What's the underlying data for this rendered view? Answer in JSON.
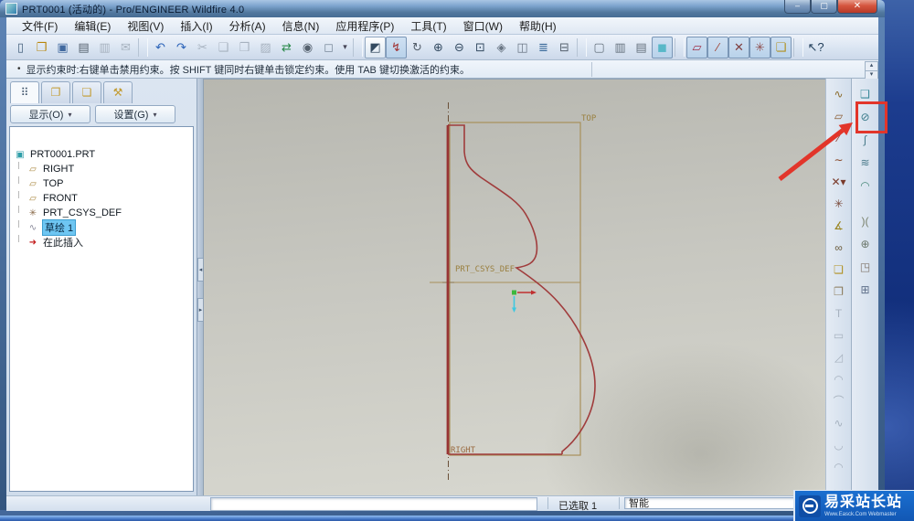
{
  "window": {
    "title": "PRT0001 (活动的) - Pro/ENGINEER Wildfire 4.0",
    "controls": {
      "minimize": "–",
      "maximize": "▢",
      "close": "✕"
    }
  },
  "menubar": {
    "items": [
      "文件(F)",
      "编辑(E)",
      "视图(V)",
      "插入(I)",
      "分析(A)",
      "信息(N)",
      "应用程序(P)",
      "工具(T)",
      "窗口(W)",
      "帮助(H)"
    ]
  },
  "toolbar": {
    "items": [
      {
        "name": "new-file-button",
        "glyph": "▯",
        "cls": "btn",
        "color": "#44607c"
      },
      {
        "name": "open-file-button",
        "glyph": "❐",
        "cls": "btn",
        "color": "#b8860b"
      },
      {
        "name": "save-button",
        "glyph": "▣",
        "cls": "btn",
        "color": "#41699f"
      },
      {
        "name": "print-button",
        "glyph": "▤",
        "cls": "btn",
        "color": "#55616e"
      },
      {
        "name": "print-to-file-button",
        "glyph": "▥",
        "cls": "btn dis"
      },
      {
        "name": "send-mail-button",
        "glyph": "✉",
        "cls": "btn dis"
      },
      {
        "cls": "sep"
      },
      {
        "name": "undo-button",
        "glyph": "↶",
        "cls": "btn",
        "color": "#2a62b8"
      },
      {
        "name": "redo-button",
        "glyph": "↷",
        "cls": "btn",
        "color": "#2a62b8"
      },
      {
        "name": "cut-button",
        "glyph": "✂",
        "cls": "btn dis"
      },
      {
        "name": "copy-button",
        "glyph": "❑",
        "cls": "btn dis"
      },
      {
        "name": "paste-button",
        "glyph": "❒",
        "cls": "btn dis"
      },
      {
        "name": "paste-special-button",
        "glyph": "▨",
        "cls": "btn dis"
      },
      {
        "name": "regenerate-button",
        "glyph": "⇄",
        "cls": "btn",
        "color": "#2a8a4a"
      },
      {
        "name": "find-button",
        "glyph": "◉",
        "cls": "btn",
        "color": "#55616e"
      },
      {
        "name": "select-box-button",
        "glyph": "◻",
        "cls": "btn",
        "color": "#7a8a9a"
      },
      {
        "name": "select-box-dropdown",
        "glyph": "▾",
        "cls": "btn dd"
      },
      {
        "cls": "sep"
      },
      {
        "name": "select-filter-button",
        "glyph": "◩",
        "cls": "btn framed",
        "color": "#334a60"
      },
      {
        "name": "smart-select-button",
        "glyph": "↯",
        "cls": "btn framed pressed",
        "color": "#a03030"
      },
      {
        "name": "advanced-select-button",
        "glyph": "↻",
        "cls": "btn",
        "color": "#555f6a"
      },
      {
        "name": "zoom-in-button",
        "glyph": "⊕",
        "cls": "btn",
        "color": "#334a60"
      },
      {
        "name": "zoom-out-button",
        "glyph": "⊖",
        "cls": "btn",
        "color": "#334a60"
      },
      {
        "name": "refit-button",
        "glyph": "⊡",
        "cls": "btn",
        "color": "#334a60"
      },
      {
        "name": "reorient-button",
        "glyph": "◈",
        "cls": "btn",
        "color": "#6a7684"
      },
      {
        "name": "saved-views-button",
        "glyph": "◫",
        "cls": "btn",
        "color": "#6a7684"
      },
      {
        "name": "layers-button",
        "glyph": "≣",
        "cls": "btn",
        "color": "#3a6a9a"
      },
      {
        "name": "view-manager-button",
        "glyph": "⊟",
        "cls": "btn",
        "color": "#55616e"
      },
      {
        "cls": "sep"
      },
      {
        "name": "wireframe-display-button",
        "glyph": "▢",
        "cls": "btn",
        "color": "#66727e"
      },
      {
        "name": "hidden-line-display-button",
        "glyph": "▥",
        "cls": "btn",
        "color": "#66727e"
      },
      {
        "name": "no-hidden-display-button",
        "glyph": "▤",
        "cls": "btn",
        "color": "#66727e"
      },
      {
        "name": "shaded-display-button",
        "glyph": "◼",
        "cls": "btn framed pressed",
        "color": "#58b8c8"
      },
      {
        "cls": "sep"
      },
      {
        "name": "datum-plane-display-toggle",
        "glyph": "▱",
        "cls": "btn framed pressed",
        "color": "#a03048"
      },
      {
        "name": "datum-axis-display-toggle",
        "glyph": "∕",
        "cls": "btn framed pressed",
        "color": "#a04030"
      },
      {
        "name": "point-display-toggle",
        "glyph": "✕",
        "cls": "btn framed pressed",
        "color": "#804040"
      },
      {
        "name": "csys-display-toggle",
        "glyph": "✳",
        "cls": "btn framed pressed",
        "color": "#905050"
      },
      {
        "name": "annotation-display-toggle",
        "glyph": "❏",
        "cls": "btn framed pressed",
        "color": "#b09020"
      },
      {
        "cls": "sep"
      },
      {
        "name": "context-help-button",
        "glyph": "↖?",
        "cls": "btn",
        "color": "#23405c"
      }
    ]
  },
  "message_bar": {
    "bullet": "•",
    "text": "显示约束时:右键单击禁用约束。按 SHIFT 键同时右键单击锁定约束。使用 TAB 键切换激活的约束。"
  },
  "navigator": {
    "tabs": [
      {
        "name": "tab-model-tree",
        "glyph": "⠿",
        "cls": "active",
        "color": "#43576e"
      },
      {
        "name": "tab-folder-browser",
        "glyph": "❐",
        "color": "#c29a2e"
      },
      {
        "name": "tab-favorites",
        "glyph": "❏",
        "color": "#c29a2e"
      },
      {
        "name": "tab-connections",
        "glyph": "⚒",
        "color": "#c29a2e"
      }
    ],
    "display_button": "显示(O)",
    "settings_button": "设置(G)",
    "caret": "▾",
    "tree": [
      {
        "label": "PRT0001.PRT",
        "icon": "part-icon",
        "glyph": "▣",
        "cls": "lvl0",
        "iconcolor": "#2f9ea8"
      },
      {
        "label": "RIGHT",
        "icon": "datum-plane-icon",
        "glyph": "▱",
        "cls": "lvl1",
        "iconcolor": "#a8863c"
      },
      {
        "label": "TOP",
        "icon": "datum-plane-icon",
        "glyph": "▱",
        "cls": "lvl1",
        "iconcolor": "#a8863c"
      },
      {
        "label": "FRONT",
        "icon": "datum-plane-icon",
        "glyph": "▱",
        "cls": "lvl1",
        "iconcolor": "#a8863c"
      },
      {
        "label": "PRT_CSYS_DEF",
        "icon": "csys-icon",
        "glyph": "✳",
        "cls": "lvl1",
        "iconcolor": "#8a6a4a"
      },
      {
        "label": "草绘 1",
        "icon": "sketch-icon",
        "glyph": "∿",
        "cls": "lvl1",
        "iconcolor": "#8a8a9a",
        "labelcls": "sel"
      },
      {
        "label": "在此插入",
        "icon": "insert-here-icon",
        "glyph": "➜",
        "cls": "lvl1",
        "iconcolor": "#c42020"
      }
    ]
  },
  "sketch": {
    "labels": {
      "top_plane": "TOP",
      "right_plane": "RIGHT",
      "csys": "PRT_CSYS_DEF"
    }
  },
  "right_toolbar_datum": {
    "items": [
      {
        "name": "datum-curve-tool",
        "glyph": "∿",
        "cls": "btn",
        "color": "#8a6a2a"
      },
      {
        "name": "datum-plane-tool",
        "glyph": "▱",
        "cls": "btn",
        "color": "#8a5a30"
      },
      {
        "name": "datum-axis-tool",
        "glyph": "∕",
        "cls": "btn",
        "color": "#8a3a2a"
      },
      {
        "name": "sketched-curve-tool",
        "glyph": "∼",
        "cls": "btn",
        "color": "#8a4a2a"
      },
      {
        "name": "datum-point-tool",
        "glyph": "✕▾",
        "cls": "btn",
        "color": "#7a3a2a"
      },
      {
        "name": "csys-tool",
        "glyph": "✳",
        "cls": "btn",
        "color": "#7a4a3a"
      },
      {
        "name": "measure-tool",
        "glyph": "∡",
        "cls": "btn",
        "color": "#9a8520"
      },
      {
        "name": "link-tool",
        "glyph": "∞",
        "cls": "btn",
        "color": "#6a5a3a"
      },
      {
        "name": "note-tool",
        "glyph": "❏",
        "cls": "btn",
        "color": "#b09020"
      },
      {
        "name": "offset-edge-tool",
        "glyph": "❐",
        "cls": "btn",
        "color": "#8a7a5a"
      },
      {
        "name": "text-tool",
        "glyph": "T",
        "cls": "btn dis"
      },
      {
        "name": "rectangle-tool",
        "glyph": "▭",
        "cls": "btn dis"
      },
      {
        "name": "chamfer-tool",
        "glyph": "◿",
        "cls": "btn dis"
      },
      {
        "name": "fillet-tool",
        "glyph": "◠",
        "cls": "btn dis"
      },
      {
        "name": "arc-tool",
        "glyph": "⌒",
        "cls": "btn dis"
      },
      {
        "name": "spline-tool",
        "glyph": "∿",
        "cls": "btn dis"
      },
      {
        "name": "conic-tool",
        "glyph": "◡",
        "cls": "btn dis"
      },
      {
        "name": "ellipse-tool",
        "glyph": "◠",
        "cls": "btn dis"
      },
      {
        "name": "offset-tool",
        "glyph": "◡",
        "cls": "btn dis"
      }
    ]
  },
  "right_toolbar_features": {
    "items": [
      {
        "name": "extrude-tool",
        "glyph": "❑",
        "cls": "btn",
        "color": "#3a8a9a"
      },
      {
        "name": "revolve-tool",
        "glyph": "⊘",
        "cls": "btn",
        "color": "#3a7a8a"
      },
      {
        "name": "sweep-tool",
        "glyph": "∫",
        "cls": "btn",
        "color": "#4a7a8a"
      },
      {
        "name": "blend-tool",
        "glyph": "≋",
        "cls": "btn",
        "color": "#4a7a8a"
      },
      {
        "name": "style-tool",
        "glyph": "◠",
        "cls": "btn",
        "color": "#4a8a7a"
      },
      {
        "cls": "gap"
      },
      {
        "name": "mirror-tool",
        "glyph": ")(",
        "cls": "btn",
        "color": "#78806a"
      },
      {
        "name": "intersect-tool",
        "glyph": "⊕",
        "cls": "btn",
        "color": "#6a766a"
      },
      {
        "name": "trim-tool",
        "glyph": "◳",
        "cls": "btn",
        "color": "#80746a"
      },
      {
        "name": "pattern-tool",
        "glyph": "⊞",
        "cls": "btn",
        "color": "#60708a"
      }
    ]
  },
  "toolbar_overflow": {
    "up": "▴",
    "down": "▾"
  },
  "splitter": {
    "left_arrow": "◂",
    "right_arrow": "▸"
  },
  "statusbar": {
    "selected": "已选取 1",
    "filter": "智能"
  },
  "watermark": {
    "title": "易采站长站",
    "subtitle": "Www.Easck.Com Webmaster"
  },
  "colors": {
    "selection_highlight": "#6ec6f2",
    "sketch_stroke": "#a03c3c",
    "datum_outline": "#a8905a",
    "annotation_red": "#e2352a",
    "watermark_blue": "#1565c0",
    "desktop_blue": "#16337f"
  }
}
